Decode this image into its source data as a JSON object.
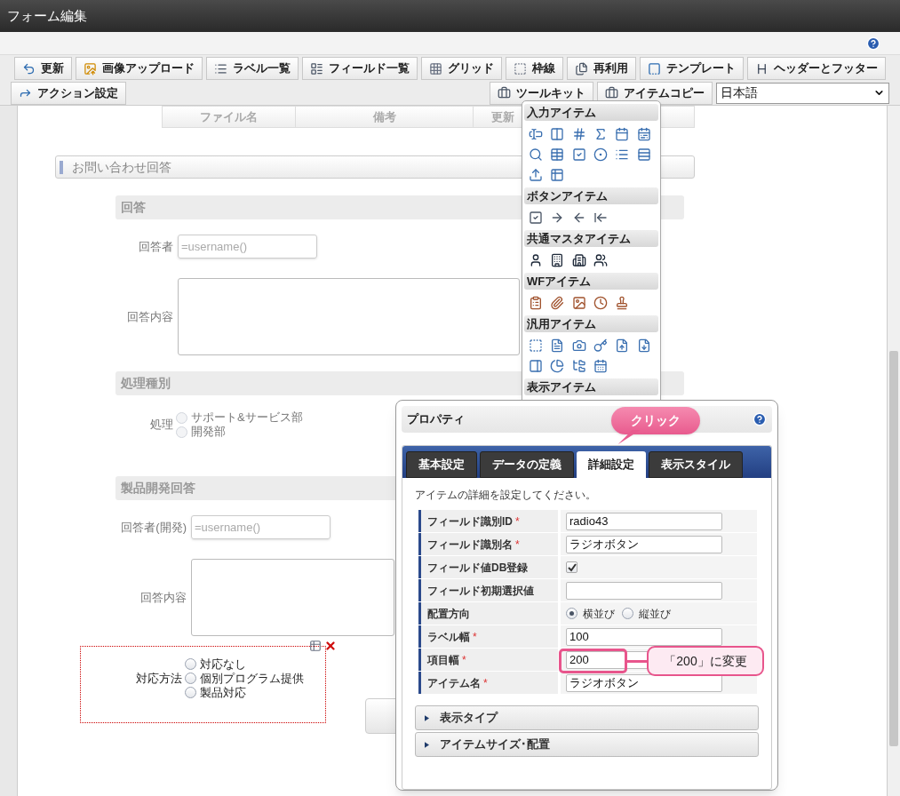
{
  "window": {
    "title": "フォーム編集"
  },
  "toolbar": {
    "row_1": [
      {
        "label": "更新"
      },
      {
        "label": "画像アップロード"
      },
      {
        "label": "ラベル一覧"
      },
      {
        "label": "フィールド一覧"
      },
      {
        "label": "グリッド"
      },
      {
        "label": "枠線"
      },
      {
        "label": "再利用"
      },
      {
        "label": "テンプレート"
      },
      {
        "label": "ヘッダーとフッター"
      }
    ],
    "row_2_left": [
      {
        "label": "アクション設定"
      }
    ],
    "row_2_right": [
      {
        "label": "ツールキット"
      },
      {
        "label": "アイテムコピー"
      }
    ],
    "language": {
      "value": "日本語"
    }
  },
  "table": {
    "columns": [
      "ファイル名",
      "備考",
      "更新"
    ]
  },
  "form": {
    "section": "お問い合わせ回答",
    "groups": [
      {
        "title": "回答",
        "fields": [
          {
            "kind": "text",
            "label": "回答者",
            "placeholder": "=username()",
            "selected": false
          },
          {
            "kind": "textarea",
            "label": "回答内容",
            "selected": false
          }
        ]
      },
      {
        "title": "処理種別",
        "fields": [
          {
            "kind": "radio",
            "label": "処理",
            "selected": false,
            "options": [
              {
                "label": "サポート&サービス部",
                "selected": false
              },
              {
                "label": "開発部",
                "selected": false
              }
            ]
          }
        ]
      },
      {
        "title": "製品開発回答",
        "fields": [
          {
            "kind": "text",
            "label": "回答者(開発)",
            "placeholder": "=username()",
            "selected": false
          },
          {
            "kind": "textarea",
            "label": "回答内容",
            "selected": false
          },
          {
            "kind": "radio",
            "label": "対応方法",
            "selected": true,
            "options": [
              {
                "label": "対応なし",
                "selected": false
              },
              {
                "label": "個別プログラム提供",
                "selected": false
              },
              {
                "label": "製品対応",
                "selected": false
              }
            ]
          }
        ]
      }
    ]
  },
  "toolkit_palette": {
    "sections": [
      {
        "title": "入力アイテム"
      },
      {
        "title": "ボタンアイテム"
      },
      {
        "title": "共通マスタアイテム"
      },
      {
        "title": "WFアイテム"
      },
      {
        "title": "汎用アイテム"
      },
      {
        "title": "表示アイテム"
      }
    ]
  },
  "properties": {
    "title": "プロパティ",
    "tabs": [
      {
        "label": "基本設定",
        "selected": false
      },
      {
        "label": "データの定義",
        "selected": false
      },
      {
        "label": "詳細設定",
        "selected": true
      },
      {
        "label": "表示スタイル",
        "selected": false
      }
    ],
    "description": "アイテムの詳細を設定してください。",
    "rows": [
      {
        "kind": "text",
        "label": "フィールド識別ID",
        "required_mark": "*",
        "value": "radio43"
      },
      {
        "kind": "text",
        "label": "フィールド識別名",
        "required_mark": "*",
        "value": "ラジオボタン"
      },
      {
        "kind": "checkbox",
        "label": "フィールド値DB登録",
        "checked": true
      },
      {
        "kind": "text",
        "label": "フィールド初期選択値"
      },
      {
        "kind": "radio",
        "label": "配置方向",
        "options": [
          {
            "label": "横並び",
            "selected": true
          },
          {
            "label": "縦並び",
            "selected": false
          }
        ]
      },
      {
        "kind": "text",
        "label": "ラベル幅",
        "required_mark": "*",
        "value": "100"
      },
      {
        "kind": "text",
        "label": "項目幅",
        "required_mark": "*",
        "value": "200"
      },
      {
        "kind": "text",
        "label": "アイテム名",
        "required_mark": "*",
        "value": "ラジオボタン"
      }
    ],
    "sections": [
      {
        "label": "表示タイプ",
        "expanded": false
      },
      {
        "label": "アイテムサイズ･配置",
        "expanded": false
      }
    ]
  },
  "callouts": [
    {
      "text": "クリック"
    },
    {
      "text": "「200」に変更"
    }
  ]
}
